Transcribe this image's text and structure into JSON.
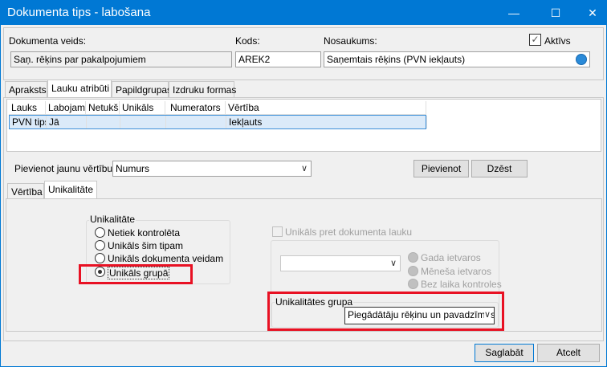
{
  "window": {
    "title": "Dokumenta tips - labošana",
    "minimize": "—",
    "maximize": "☐",
    "close": "✕"
  },
  "header": {
    "doc_type_label": "Dokumenta veids:",
    "doc_type_value": "Saņ. rēķins par pakalpojumiem",
    "code_label": "Kods:",
    "code_value": "AREK2",
    "name_label": "Nosaukums:",
    "name_value": "Saņemtais rēķins (PVN iekļauts)",
    "active_label": "Aktīvs",
    "active_checked": true,
    "check": "✓"
  },
  "tabs": [
    "Apraksts",
    "Lauku atribūti",
    "Papildgrupas",
    "Izdruku formas"
  ],
  "grid": {
    "columns": [
      "Lauks",
      "Labojams",
      "Netukšs",
      "Unikāls",
      "Numerators",
      "Vērtība"
    ],
    "rows": [
      [
        "PVN tips",
        "Jā",
        "",
        "",
        "",
        "Iekļauts"
      ]
    ]
  },
  "add_value": {
    "label": "Pievienot jaunu vērtību:",
    "selected": "Numurs",
    "add_button": "Pievienot",
    "delete_button": "Dzēst"
  },
  "inner_tabs": [
    "Vērtība",
    "Unikalitāte"
  ],
  "uniqueness": {
    "group_title": "Unikalitāte",
    "options": [
      "Netiek kontrolēta",
      "Unikāls šim tipam",
      "Unikāls dokumenta veidam",
      "Unikāls grupā"
    ],
    "selected_index": 3,
    "doc_field_checkbox": "Unikāls pret dokumenta lauku",
    "period_options": [
      "Gada ietvaros",
      "Mēneša ietvaros",
      "Bez laika kontroles"
    ],
    "group_box_title": "Unikalitātes grupa",
    "group_value": "Piegādātāju rēķinu un pavadzīmes"
  },
  "footer": {
    "save": "Saglabāt",
    "cancel": "Atcelt"
  },
  "colors": {
    "title_bar": "#0078d4",
    "highlight": "#e81123",
    "selected_row": "#dbeaf9"
  }
}
